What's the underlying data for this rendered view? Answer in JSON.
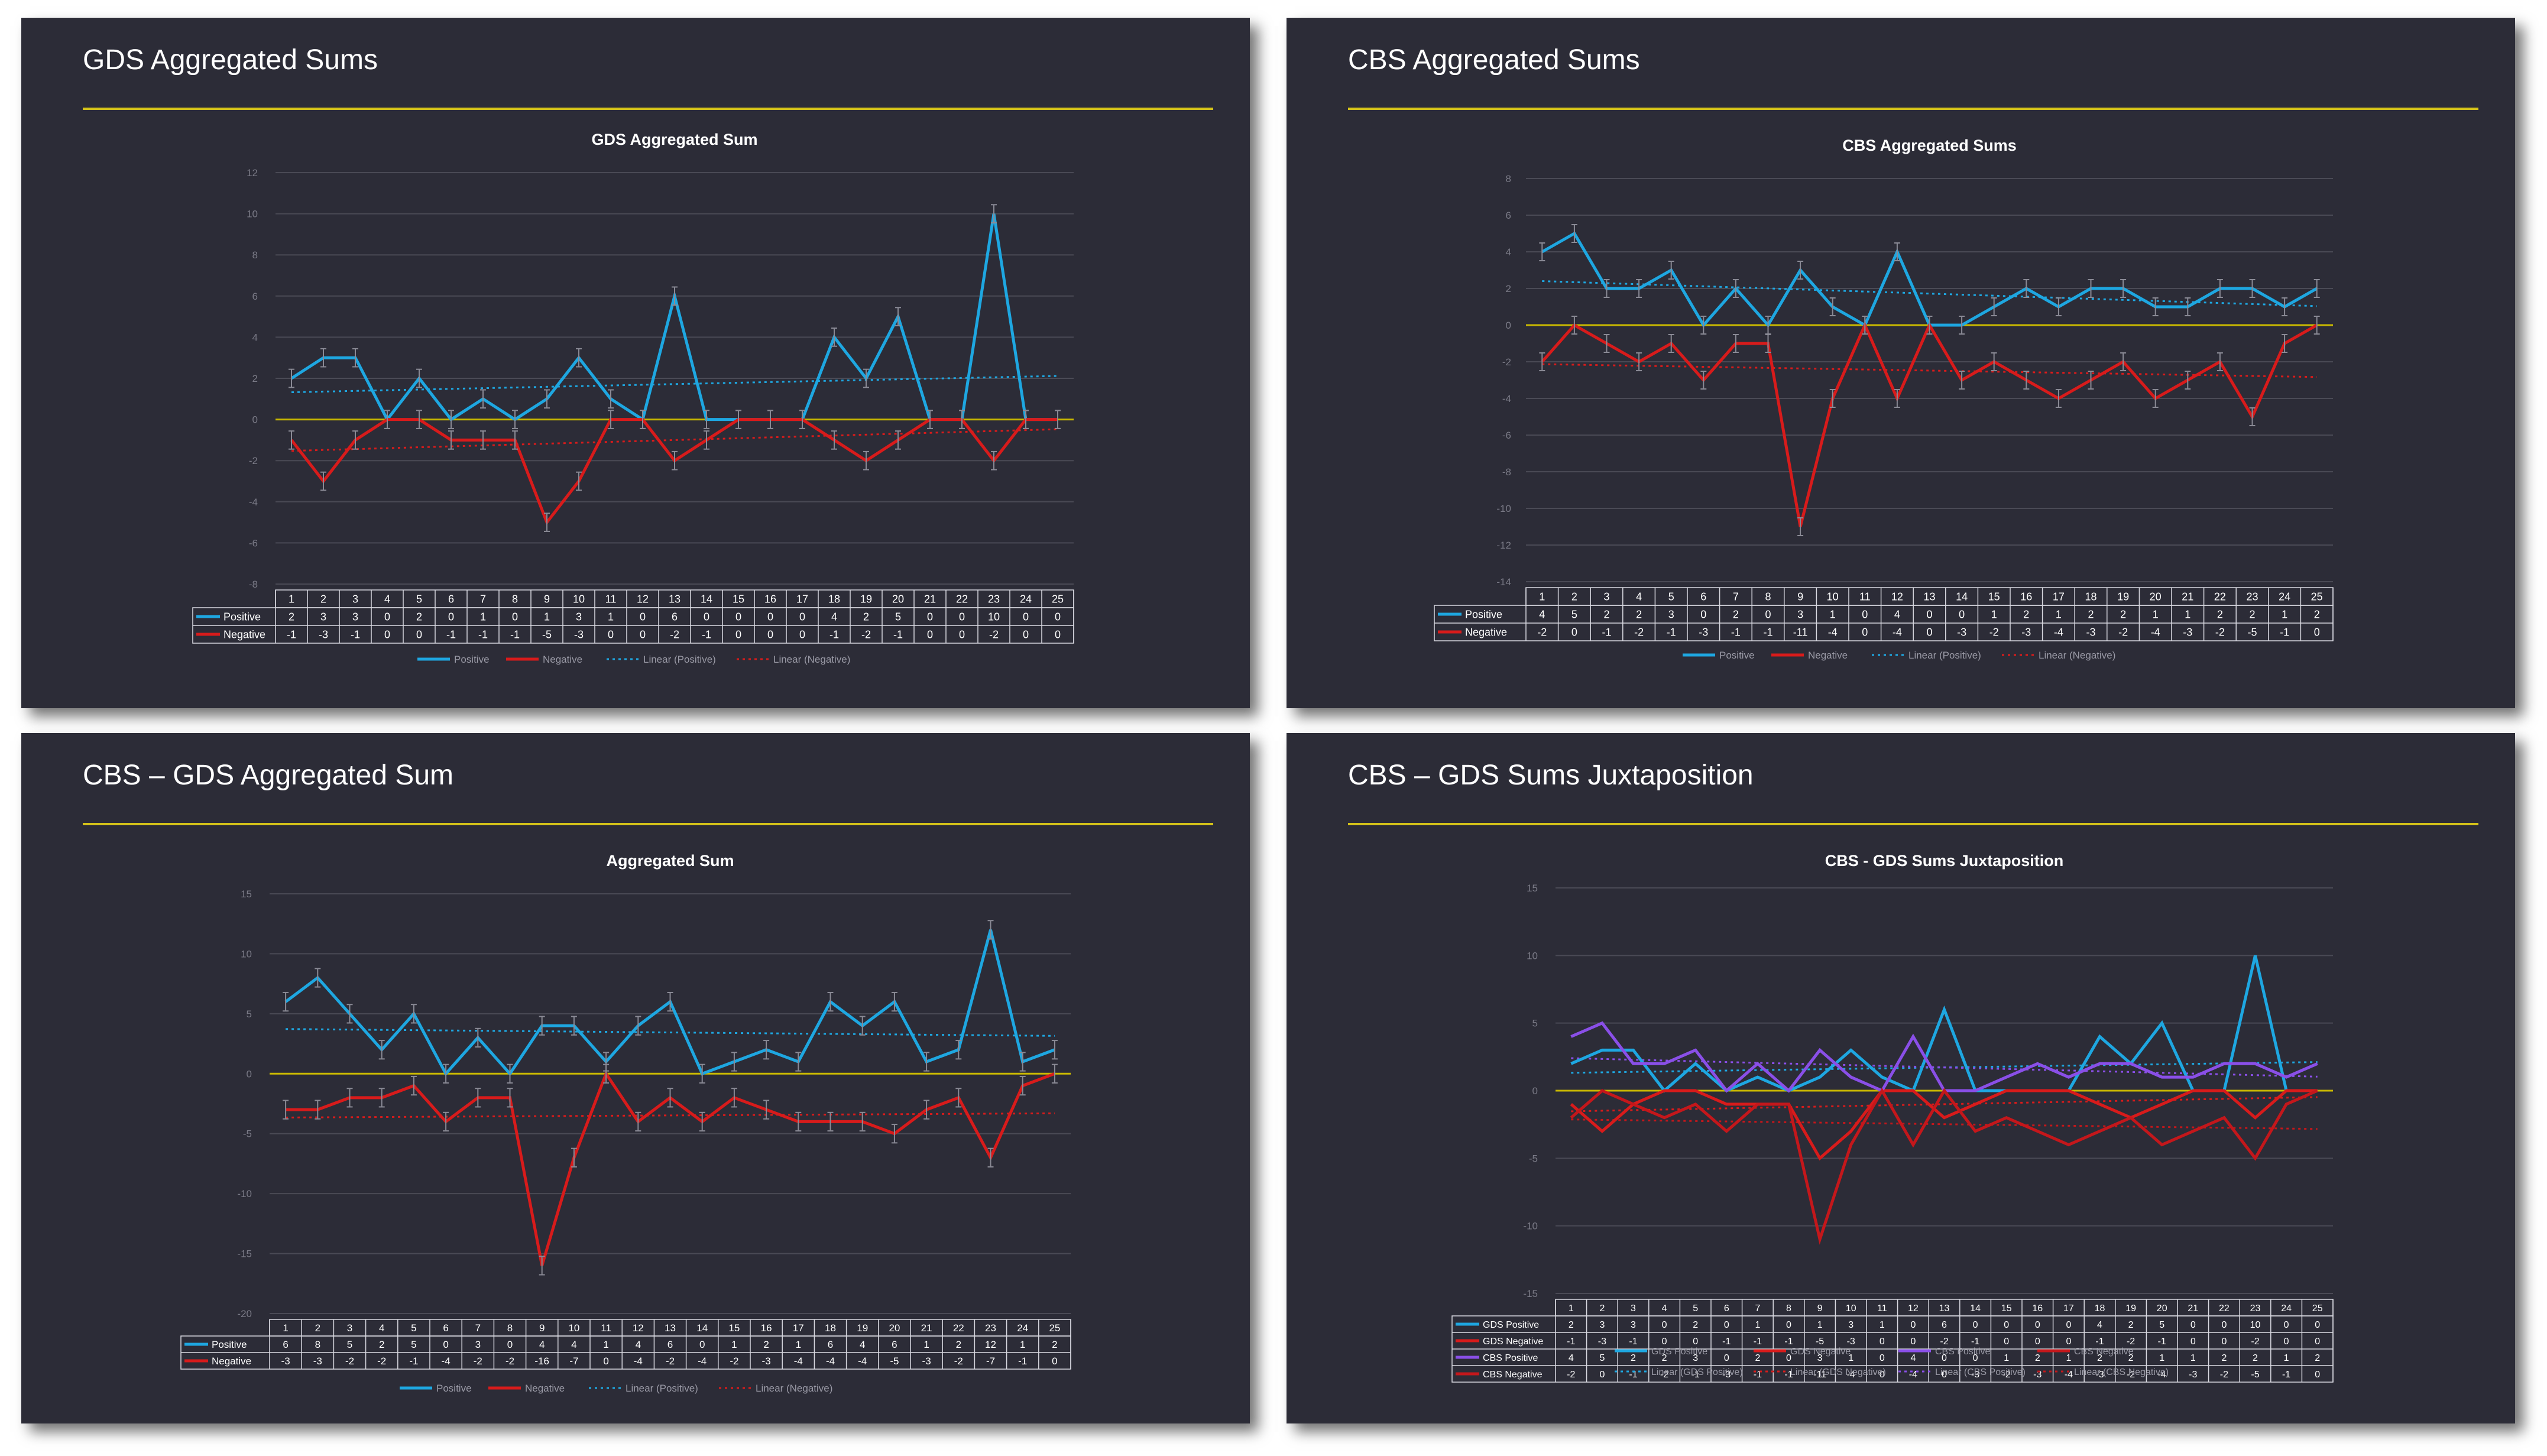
{
  "colors": {
    "background": "#ffffff",
    "slide_bg": "#2c2c37",
    "title_rule": "#d4c21a",
    "zero_line": "#c9b800",
    "gds_positive": "#1ea7e1",
    "gds_negative": "#d81b1b",
    "cbs_positive": "#8a4fe8",
    "cbs_negative": "#c4171b",
    "grid": "#4a4a55"
  },
  "slides": [
    {
      "title": "GDS Aggregated Sums",
      "chart_data": {
        "type": "line",
        "title": "GDS Aggregated Sum",
        "categories": [
          "1",
          "2",
          "3",
          "4",
          "5",
          "6",
          "7",
          "8",
          "9",
          "10",
          "11",
          "12",
          "13",
          "14",
          "15",
          "16",
          "17",
          "18",
          "19",
          "20",
          "21",
          "22",
          "23",
          "24",
          "25"
        ],
        "series": [
          {
            "name": "Positive",
            "color": "#1ea7e1",
            "values": [
              2,
              3,
              3,
              0,
              2,
              0,
              1,
              0,
              1,
              3,
              1,
              0,
              6,
              0,
              0,
              0,
              0,
              4,
              2,
              5,
              0,
              0,
              10,
              0,
              0
            ]
          },
          {
            "name": "Negative",
            "color": "#d81b1b",
            "values": [
              -1,
              -3,
              -1,
              0,
              0,
              -1,
              -1,
              -1,
              -5,
              -3,
              0,
              0,
              -2,
              -1,
              0,
              0,
              0,
              -1,
              -2,
              -1,
              0,
              0,
              -2,
              0,
              0
            ]
          }
        ],
        "ylim": [
          -6,
          12
        ],
        "yticks": [
          "12",
          "10",
          "8",
          "6",
          "4",
          "2",
          "0",
          "-2",
          "-4",
          "-6",
          "-8"
        ],
        "trendlines": true,
        "error_bars": true,
        "data_table": true,
        "legend_position": "bottom",
        "legend": [
          "Positive",
          "Negative",
          "Linear (Positive)",
          "Linear (Negative)"
        ]
      }
    },
    {
      "title": "CBS Aggregated Sums",
      "chart_data": {
        "type": "line",
        "title": "CBS Aggregated Sums",
        "categories": [
          "1",
          "2",
          "3",
          "4",
          "5",
          "6",
          "7",
          "8",
          "9",
          "10",
          "11",
          "12",
          "13",
          "14",
          "15",
          "16",
          "17",
          "18",
          "19",
          "20",
          "21",
          "22",
          "23",
          "24",
          "25"
        ],
        "series": [
          {
            "name": "Positive",
            "color": "#1ea7e1",
            "values": [
              4,
              5,
              2,
              2,
              3,
              0,
              2,
              0,
              3,
              1,
              0,
              4,
              0,
              0,
              1,
              2,
              1,
              2,
              2,
              1,
              1,
              2,
              2,
              1,
              2
            ]
          },
          {
            "name": "Negative",
            "color": "#d81b1b",
            "values": [
              -2,
              0,
              -1,
              -2,
              -1,
              -3,
              -1,
              -1,
              -11,
              -4,
              0,
              -4,
              0,
              -3,
              -2,
              -3,
              -4,
              -3,
              -2,
              -4,
              -3,
              -2,
              -5,
              -1,
              0
            ]
          }
        ],
        "ylim": [
          -14,
          8
        ],
        "yticks": [
          "8",
          "6",
          "4",
          "2",
          "0",
          "-2",
          "-4",
          "-6",
          "-8",
          "-10",
          "-12",
          "-14"
        ],
        "trendlines": true,
        "error_bars": true,
        "data_table": true,
        "legend_position": "bottom",
        "legend": [
          "Positive",
          "Negative",
          "Linear (Positive)",
          "Linear (Negative)"
        ]
      }
    },
    {
      "title": "CBS – GDS Aggregated Sum",
      "chart_data": {
        "type": "line",
        "title": "Aggregated Sum",
        "categories": [
          "1",
          "2",
          "3",
          "4",
          "5",
          "6",
          "7",
          "8",
          "9",
          "10",
          "11",
          "12",
          "13",
          "14",
          "15",
          "16",
          "17",
          "18",
          "19",
          "20",
          "21",
          "22",
          "23",
          "24",
          "25"
        ],
        "series": [
          {
            "name": "Positive",
            "color": "#1ea7e1",
            "values": [
              6,
              8,
              5,
              2,
              5,
              0,
              3,
              0,
              4,
              4,
              1,
              4,
              6,
              0,
              1,
              2,
              1,
              6,
              4,
              6,
              1,
              2,
              12,
              1,
              2
            ]
          },
          {
            "name": "Negative",
            "color": "#d81b1b",
            "values": [
              -3,
              -3,
              -2,
              -2,
              -1,
              -4,
              -2,
              -2,
              -16,
              -7,
              0,
              -4,
              -2,
              -4,
              -2,
              -3,
              -4,
              -4,
              -4,
              -5,
              -3,
              -2,
              -7,
              -1,
              0
            ]
          }
        ],
        "ylim": [
          -20,
          15
        ],
        "yticks": [
          "15",
          "10",
          "5",
          "0",
          "-5",
          "-10",
          "-15",
          "-20"
        ],
        "trendlines": true,
        "error_bars": true,
        "data_table": true,
        "legend_position": "bottom",
        "legend": [
          "Positive",
          "Negative",
          "Linear (Positive)",
          "Linear (Negative)"
        ]
      }
    },
    {
      "title": "CBS – GDS Sums Juxtaposition",
      "chart_data": {
        "type": "line",
        "title": "CBS - GDS Sums Juxtaposition",
        "categories": [
          "1",
          "2",
          "3",
          "4",
          "5",
          "6",
          "7",
          "8",
          "9",
          "10",
          "11",
          "12",
          "13",
          "14",
          "15",
          "16",
          "17",
          "18",
          "19",
          "20",
          "21",
          "22",
          "23",
          "24",
          "25"
        ],
        "series": [
          {
            "name": "GDS Positive",
            "color": "#1ea7e1",
            "values": [
              2,
              3,
              3,
              0,
              2,
              0,
              1,
              0,
              1,
              3,
              1,
              0,
              6,
              0,
              0,
              0,
              0,
              4,
              2,
              5,
              0,
              0,
              10,
              0,
              0
            ]
          },
          {
            "name": "GDS Negative",
            "color": "#d81b1b",
            "values": [
              -1,
              -3,
              -1,
              0,
              0,
              -1,
              -1,
              -1,
              -5,
              -3,
              0,
              0,
              -2,
              -1,
              0,
              0,
              0,
              -1,
              -2,
              -1,
              0,
              0,
              -2,
              0,
              0
            ]
          },
          {
            "name": "CBS Positive",
            "color": "#8a4fe8",
            "values": [
              4,
              5,
              2,
              2,
              3,
              0,
              2,
              0,
              3,
              1,
              0,
              4,
              0,
              0,
              1,
              2,
              1,
              2,
              2,
              1,
              1,
              2,
              2,
              1,
              2
            ]
          },
          {
            "name": "CBS Negative",
            "color": "#c4171b",
            "values": [
              -2,
              0,
              -1,
              -2,
              -1,
              -3,
              -1,
              -1,
              -11,
              -4,
              0,
              -4,
              0,
              -3,
              -2,
              -3,
              -4,
              -3,
              -2,
              -4,
              -3,
              -2,
              -5,
              -1,
              0
            ]
          }
        ],
        "ylim": [
          -15,
          15
        ],
        "yticks": [
          "15",
          "10",
          "5",
          "0",
          "-5",
          "-10",
          "-15"
        ],
        "trendlines": true,
        "error_bars": false,
        "data_table": true,
        "legend_position": "bottom",
        "legend": [
          "GDS Positive",
          "GDS Negative",
          "CBS Positive",
          "CBS Negative",
          "Linear (GDS Positive)",
          "Linear (GDS Negative)",
          "Linear (CBS Positive)",
          "Linear (CBS Negative)"
        ]
      }
    }
  ]
}
